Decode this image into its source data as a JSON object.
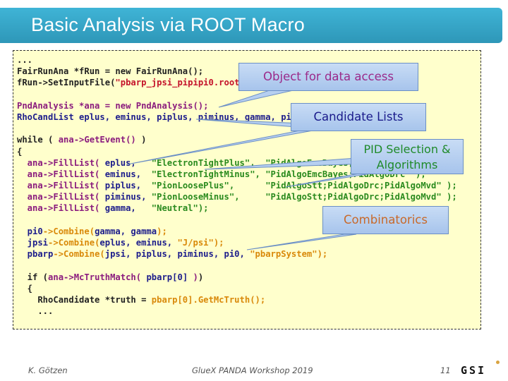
{
  "title": "Basic Analysis via ROOT Macro",
  "code_lines": [
    [
      {
        "c": "k",
        "t": "..."
      }
    ],
    [
      {
        "c": "k",
        "t": "FairRunAna *fRun = new FairRunAna();"
      }
    ],
    [
      {
        "c": "k",
        "t": "fRun->SetInputFile("
      },
      {
        "c": "r",
        "t": "\"pbarp_jpsi_pipipi0.root\""
      },
      {
        "c": "k",
        "t": ");"
      }
    ],
    [],
    [
      {
        "c": "m",
        "t": "PndAnalysis *ana = new PndAnalysis();"
      }
    ],
    [
      {
        "c": "b",
        "t": "RhoCandList eplus, eminus, piplus, piminus, gamma, pi0, jpsi, pbarp;"
      }
    ],
    [],
    [
      {
        "c": "k",
        "t": "while ( "
      },
      {
        "c": "m",
        "t": "ana->GetEvent()"
      },
      {
        "c": "k",
        "t": " )"
      }
    ],
    [
      {
        "c": "k",
        "t": "{"
      }
    ],
    [
      {
        "c": "m",
        "t": "  ana->FillList( "
      },
      {
        "c": "b",
        "t": "eplus,   "
      },
      {
        "c": "s",
        "t": "\"ElectronTightPlus\",  \"PidAlgoEmcBayes;PidAlgoDrc\" );"
      }
    ],
    [
      {
        "c": "m",
        "t": "  ana->FillList( "
      },
      {
        "c": "b",
        "t": "eminus,  "
      },
      {
        "c": "s",
        "t": "\"ElectronTightMinus\", \"PidAlgoEmcBayes;PidAlgoDrc\" );"
      }
    ],
    [
      {
        "c": "m",
        "t": "  ana->FillList( "
      },
      {
        "c": "b",
        "t": "piplus,  "
      },
      {
        "c": "s",
        "t": "\"PionLoosePlus\",      \"PidAlgoStt;PidAlgoDrc;PidAlgoMvd\" );"
      }
    ],
    [
      {
        "c": "m",
        "t": "  ana->FillList( "
      },
      {
        "c": "b",
        "t": "piminus, "
      },
      {
        "c": "s",
        "t": "\"PionLooseMinus\",     \"PidAlgoStt;PidAlgoDrc;PidAlgoMvd\" );"
      }
    ],
    [
      {
        "c": "m",
        "t": "  ana->FillList( "
      },
      {
        "c": "b",
        "t": "gamma,   "
      },
      {
        "c": "s",
        "t": "\"Neutral\");"
      }
    ],
    [],
    [
      {
        "c": "b",
        "t": "  pi0"
      },
      {
        "c": "o",
        "t": "->Combine("
      },
      {
        "c": "b",
        "t": "gamma, gamma"
      },
      {
        "c": "o",
        "t": ");"
      }
    ],
    [
      {
        "c": "b",
        "t": "  jpsi"
      },
      {
        "c": "o",
        "t": "->Combine("
      },
      {
        "c": "b",
        "t": "eplus, eminus, "
      },
      {
        "c": "o",
        "t": "\"J/psi\");"
      }
    ],
    [
      {
        "c": "b",
        "t": "  pbarp"
      },
      {
        "c": "o",
        "t": "->Combine("
      },
      {
        "c": "b",
        "t": "jpsi, piplus, piminus, pi0, "
      },
      {
        "c": "o",
        "t": "\"pbarpSystem\");"
      }
    ],
    [],
    [
      {
        "c": "k",
        "t": "  if ("
      },
      {
        "c": "m",
        "t": "ana->McTruthMatch( "
      },
      {
        "c": "b",
        "t": "pbarp[0]"
      },
      {
        "c": "m",
        "t": " )"
      },
      {
        "c": "k",
        "t": ")"
      }
    ],
    [
      {
        "c": "k",
        "t": "  {"
      }
    ],
    [
      {
        "c": "k",
        "t": "    RhoCandidate *truth = "
      },
      {
        "c": "o",
        "t": "pbarp[0].GetMcTruth();"
      }
    ],
    [
      {
        "c": "k",
        "t": "    ..."
      }
    ]
  ],
  "callouts": {
    "data_access": {
      "text": "Object for data access",
      "color": "#9b2a8a"
    },
    "candidate_lists": {
      "text": "Candidate Lists",
      "color": "#1a1a8b"
    },
    "pid_line1": "PID Selection &",
    "pid_line2": "Algorithms",
    "pid_color": "#1f8a2a",
    "combinatorics": {
      "text": "Combinatorics",
      "color": "#c8692a"
    }
  },
  "footer": {
    "author": "K. Götzen",
    "event": "GlueX PANDA Workshop 2019",
    "page": "11",
    "logo": "GSI"
  }
}
